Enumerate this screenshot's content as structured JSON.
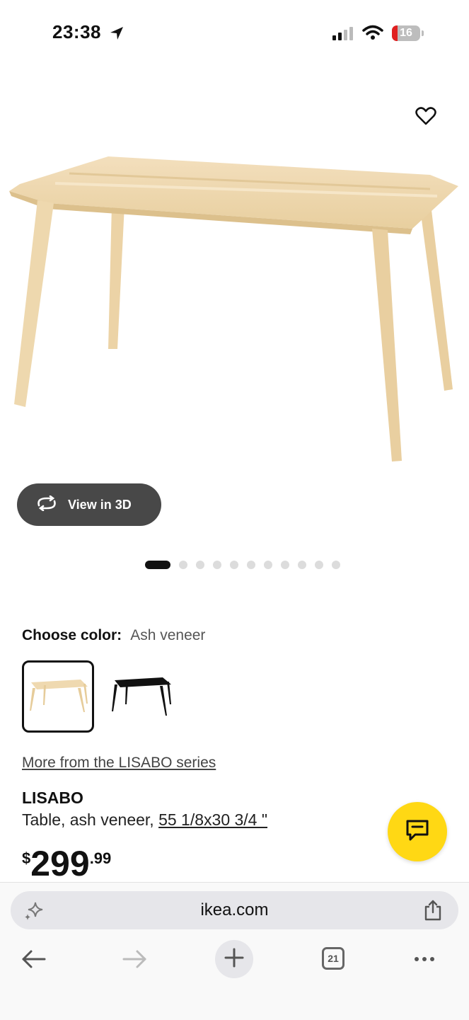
{
  "status_bar": {
    "time": "23:38",
    "battery": "16"
  },
  "product": {
    "view_3d_label": "View in 3D",
    "gallery_image_count": 11,
    "gallery_active_index": 0,
    "color_label": "Choose color:",
    "color_value": "Ash veneer",
    "series_link": "More from the LISABO series",
    "name": "LISABO",
    "description_prefix": "Table, ash veneer,",
    "size_link": "55 1/8x30 3/4 \"",
    "price_currency": "$",
    "price_int": "299",
    "price_dec": ".99"
  },
  "browser": {
    "url": "ikea.com",
    "tab_count": "21"
  },
  "colors": {
    "accent_yellow": "#ffd814",
    "button_dark": "#484848",
    "battery_low": "#e02020"
  },
  "icons": [
    "location-arrow-icon",
    "signal-icon",
    "wifi-icon",
    "battery-icon",
    "heart-icon",
    "rotate-3d-icon",
    "chat-icon",
    "sparkle-icon",
    "share-icon",
    "back-arrow-icon",
    "forward-arrow-icon",
    "plus-icon",
    "tabs-icon",
    "more-icon"
  ]
}
